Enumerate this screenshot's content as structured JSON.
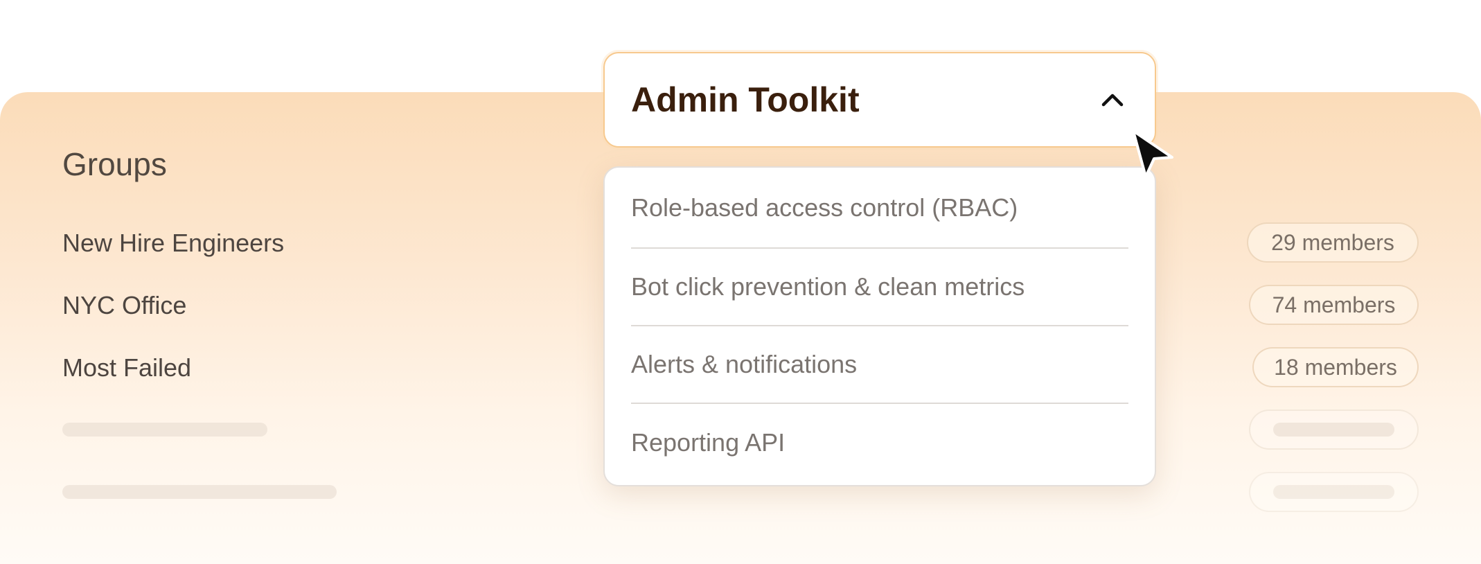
{
  "dropdown": {
    "selected": "Admin Toolkit",
    "expanded": true,
    "chevron_icon": "chevron-up-icon",
    "items": [
      {
        "label": "Role-based access control (RBAC)"
      },
      {
        "label": "Bot click prevention & clean metrics"
      },
      {
        "label": "Alerts & notifications"
      },
      {
        "label": "Reporting API"
      }
    ]
  },
  "groups": {
    "title": "Groups",
    "rows": [
      {
        "name": "New Hire Engineers",
        "members": "29 members"
      },
      {
        "name": "NYC Office",
        "members": "74 members"
      },
      {
        "name": "Most Failed",
        "members": "18 members"
      }
    ],
    "placeholder_rows": 2
  },
  "colors": {
    "accent_border": "#f7c98e",
    "card_gradient_top": "#fbdcb9",
    "card_gradient_bottom": "#fffbf6",
    "heading_text": "#3a1f0d"
  },
  "cursor_icon": "mouse-pointer-icon"
}
